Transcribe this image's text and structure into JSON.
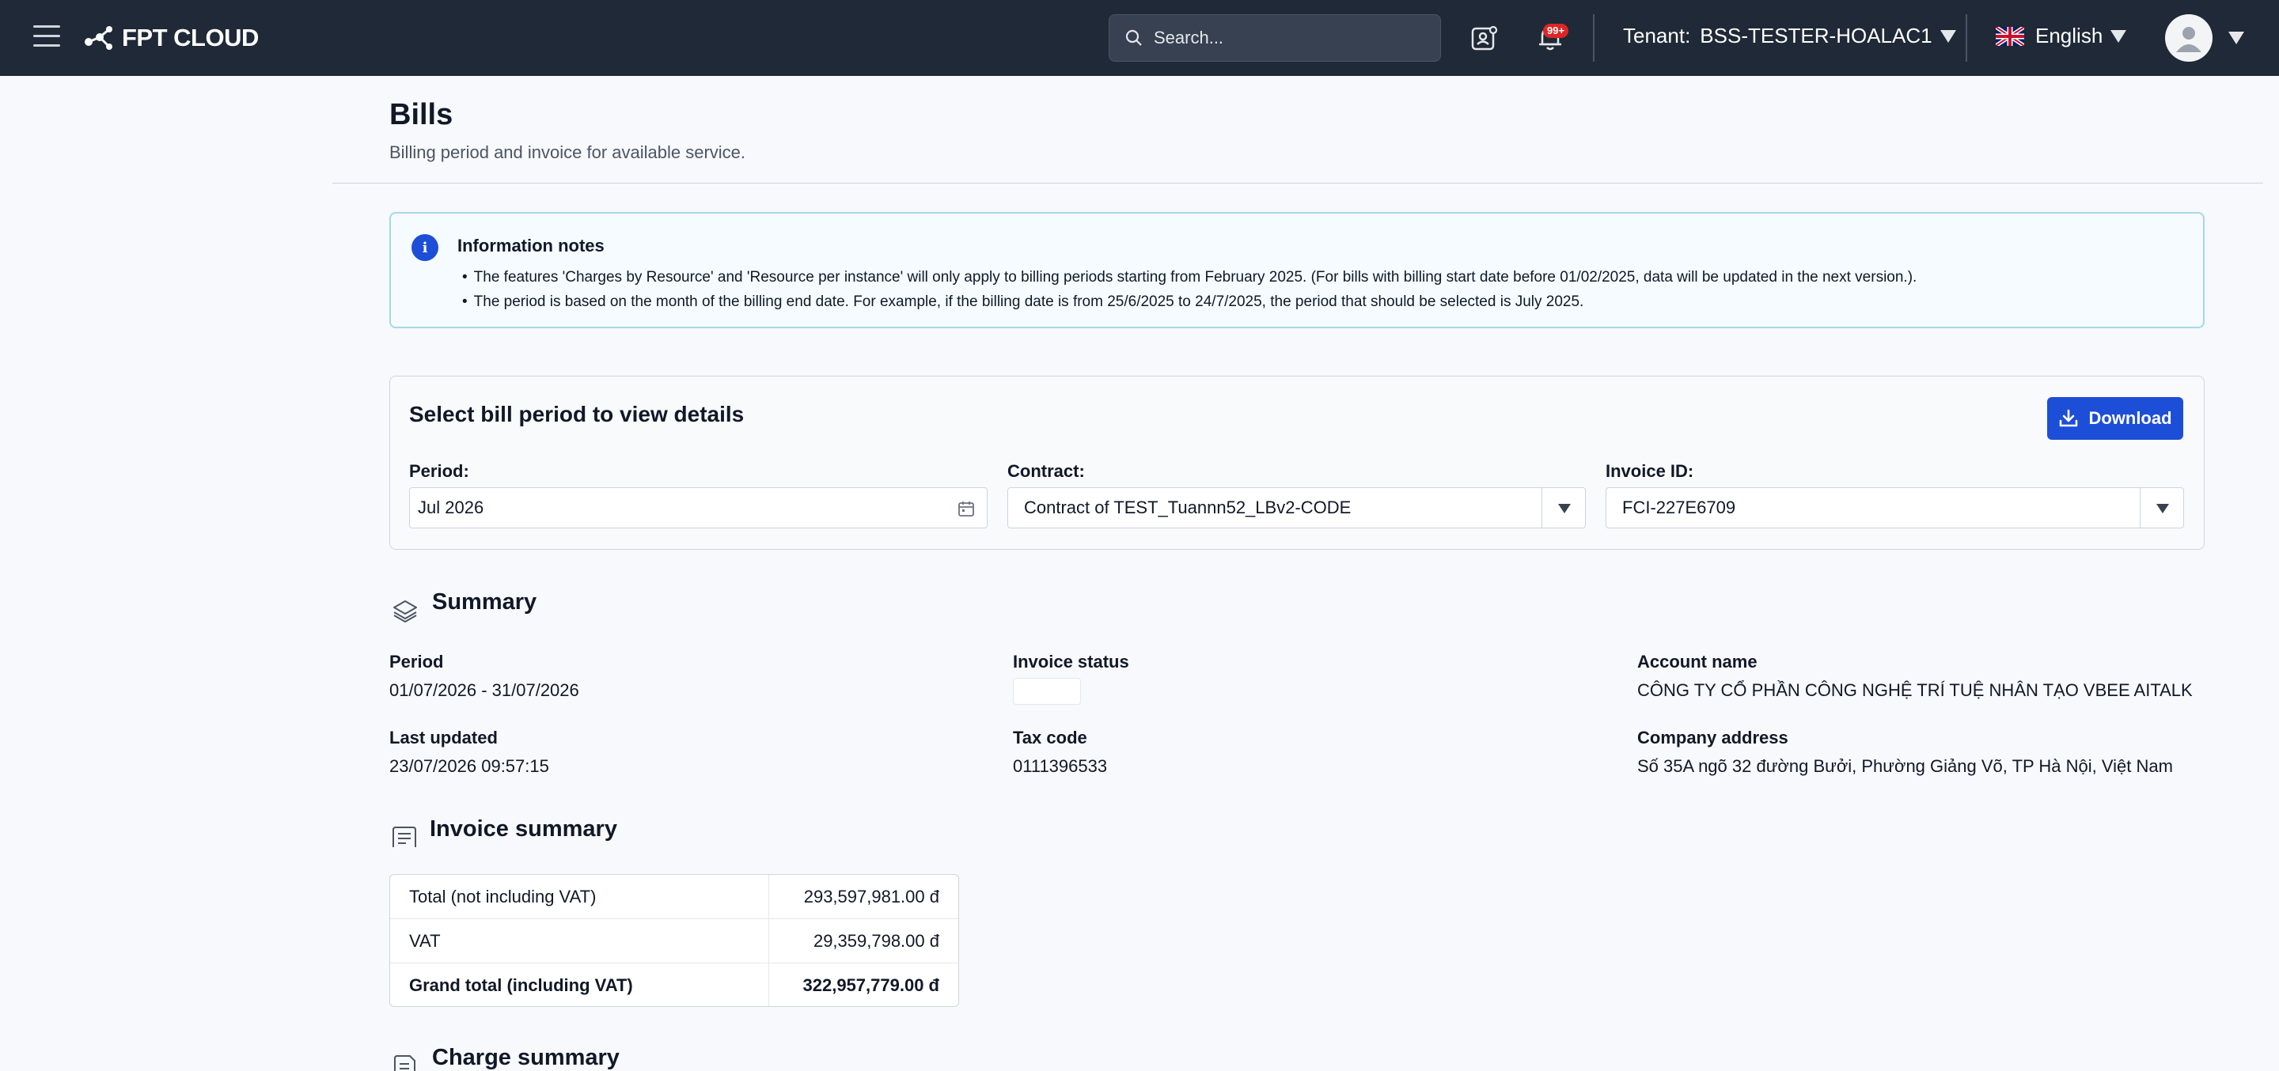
{
  "navbar": {
    "brand": "FPT CLOUD",
    "search_placeholder": "Search...",
    "notif_badge": "99+",
    "tenant_label": "Tenant:",
    "tenant_value": "BSS-TESTER-HOALAC1",
    "language": "English"
  },
  "page": {
    "title": "Bills",
    "subtitle": "Billing period and invoice for available service."
  },
  "info": {
    "title": "Information notes",
    "notes": [
      "The features 'Charges by Resource' and 'Resource per instance' will only apply to billing periods starting from February 2025. (For bills with billing start date before 01/02/2025, data will be updated in the next version.).",
      "The period is based on the month of the billing end date. For example, if the billing date is from 25/6/2025 to 24/7/2025, the period that should be selected is July 2025."
    ]
  },
  "bill_select": {
    "title": "Select bill period to view details",
    "download_label": "Download",
    "period_label": "Period:",
    "period_value": "Jul 2026",
    "contract_label": "Contract:",
    "contract_value": "Contract of TEST_Tuannn52_LBv2-CODE",
    "invoice_label": "Invoice ID:",
    "invoice_value": "FCI-227E6709"
  },
  "summary": {
    "title": "Summary",
    "period_label": "Period",
    "period_value": "01/07/2026 - 31/07/2026",
    "last_updated_label": "Last updated",
    "last_updated_value": "23/07/2026 09:57:15",
    "invoice_status_label": "Invoice status",
    "tax_code_label": "Tax code",
    "tax_code_value": "0111396533",
    "account_name_label": "Account name",
    "account_name_value": "CÔNG TY CỔ PHẦN CÔNG NGHỆ TRÍ TUỆ NHÂN TẠO VBEE AITALK",
    "company_address_label": "Company address",
    "company_address_value": "Số 35A ngõ 32 đường Bưởi, Phường Giảng Võ, TP Hà Nội, Việt Nam"
  },
  "invoice_summary": {
    "title": "Invoice summary",
    "rows": [
      {
        "label": "Total (not including VAT)",
        "value": "293,597,981.00 đ"
      },
      {
        "label": "VAT",
        "value": "29,359,798.00 đ"
      },
      {
        "label": "Grand total (including VAT)",
        "value": "322,957,779.00 đ"
      }
    ]
  },
  "charge_summary": {
    "title": "Charge summary"
  }
}
